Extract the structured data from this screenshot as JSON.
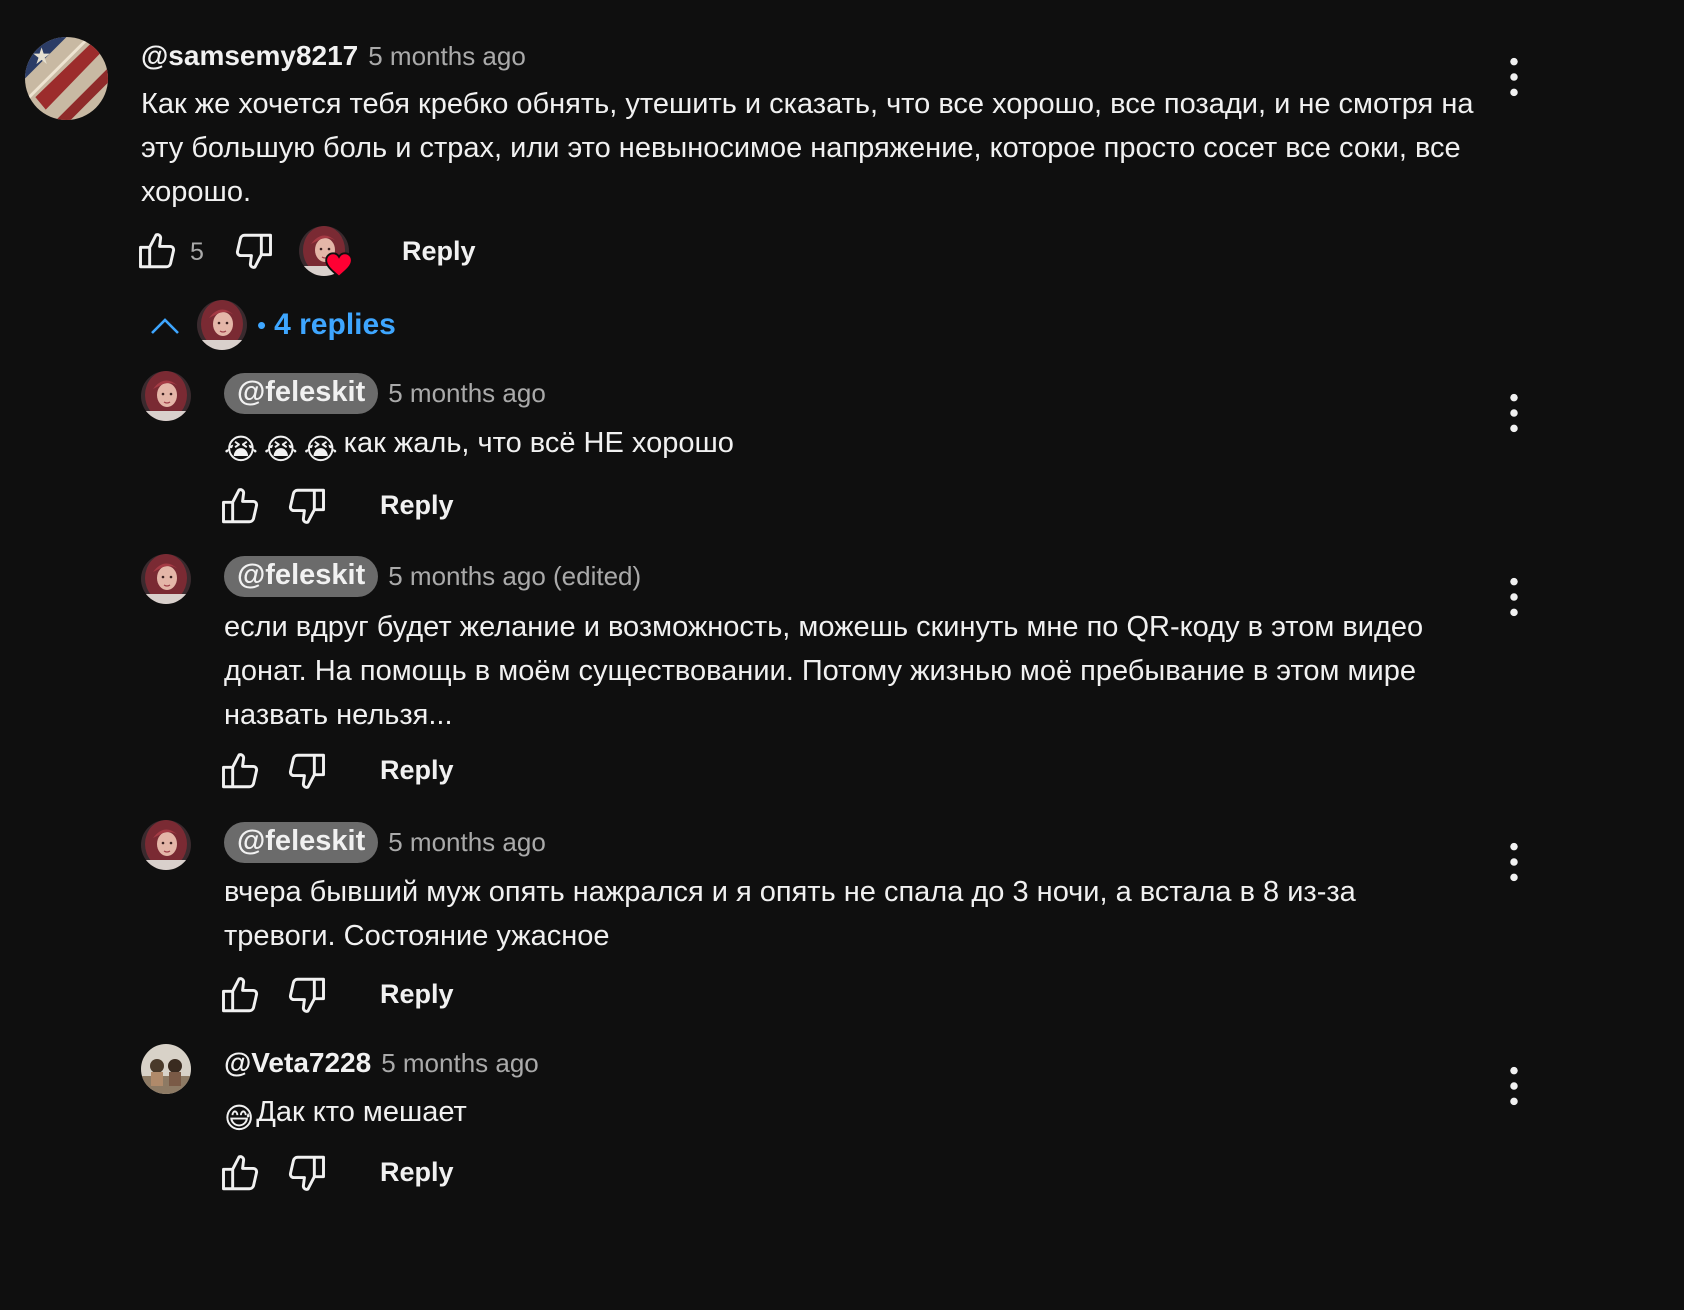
{
  "main_comment": {
    "author": "@samsemy8217",
    "time": "5 months ago",
    "text": "Как же хочется тебя кребко обнять, утешить и сказать, что все хорошо, все позади, и не смотря на эту большую боль и страх, или это невыносимое напряжение, которое просто сосет все соки, все хорошо.",
    "likes": "5",
    "reply_label": "Reply",
    "avatar_icon": "flag-avatar",
    "creator_heart_icon": "creator-heart-icon"
  },
  "replies_toggle": {
    "label": "4 replies",
    "separator": "•",
    "icon": "chevron-up-icon"
  },
  "replies": [
    {
      "author": "@feleskit",
      "time": "5 months ago",
      "emoji": [
        "😭",
        "😭",
        "😭"
      ],
      "text": "как жаль, что всё НЕ хорошо",
      "reply_label": "Reply"
    },
    {
      "author": "@feleskit",
      "time": "5 months ago (edited)",
      "text": "если вдруг будет желание и возможность, можешь скинуть мне по QR-коду в этом видео донат. На помощь в моём существовании. Потому жизнью моё пребывание в этом мире назвать нельзя...",
      "reply_label": "Reply"
    },
    {
      "author": "@feleskit",
      "time": "5 months ago",
      "text": "вчера бывший муж опять нажрался и я опять не спала до 3 ночи, а встала в 8 из-за тревоги. Состояние ужасное",
      "reply_label": "Reply"
    },
    {
      "author": "@Veta7228",
      "time": "5 months ago",
      "emoji": [
        "😅"
      ],
      "text": "Дак кто мешает",
      "reply_label": "Reply"
    }
  ],
  "colors": {
    "background": "#0f0f0f",
    "text": "#f1f1f1",
    "secondary": "#aaaaaa",
    "link_blue": "#3ea6ff",
    "author_pill": "#6b6b6b",
    "heart": "#ff0033"
  }
}
